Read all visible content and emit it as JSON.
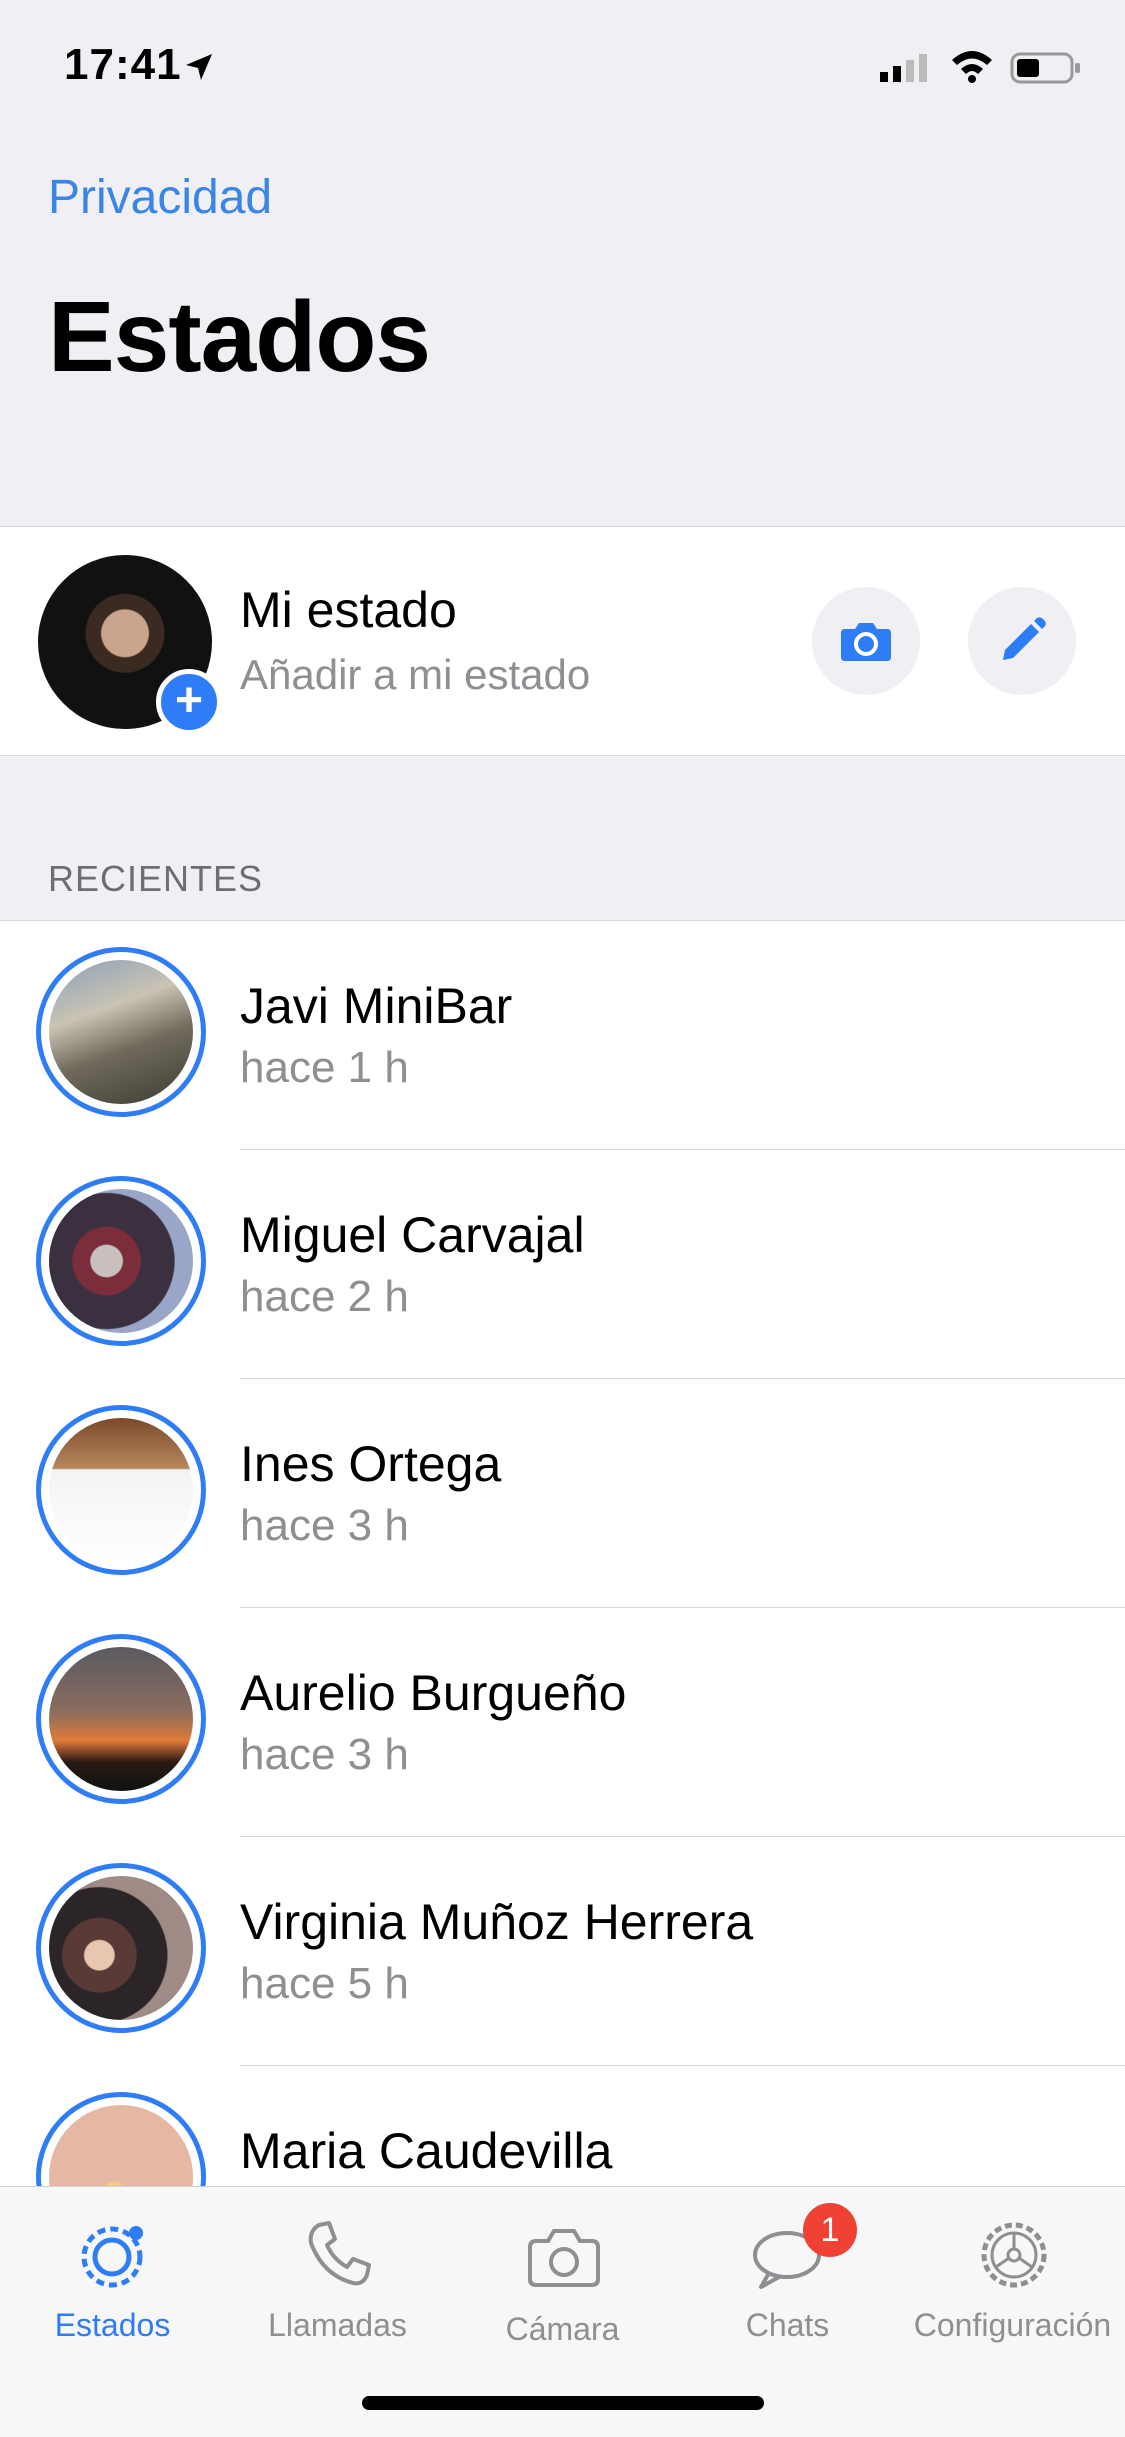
{
  "status_bar": {
    "time": "17:41"
  },
  "header": {
    "privacy_link": "Privacidad",
    "title": "Estados"
  },
  "my_status": {
    "name": "Mi estado",
    "subtitle": "Añadir a mi estado"
  },
  "section": {
    "recent_label": "RECIENTES"
  },
  "contacts": [
    {
      "name": "Javi MiniBar",
      "time": "hace 1 h"
    },
    {
      "name": "Miguel Carvajal",
      "time": "hace 2 h"
    },
    {
      "name": "Ines Ortega",
      "time": "hace 3 h"
    },
    {
      "name": "Aurelio Burgueño",
      "time": "hace 3 h"
    },
    {
      "name": "Virginia Muñoz Herrera",
      "time": "hace 5 h"
    },
    {
      "name": "Maria Caudevilla",
      "time": ""
    }
  ],
  "tabs": [
    {
      "label": "Estados",
      "active": true
    },
    {
      "label": "Llamadas"
    },
    {
      "label": "Cámara"
    },
    {
      "label": "Chats",
      "badge": "1"
    },
    {
      "label": "Configuración"
    }
  ],
  "colors": {
    "accent": "#2e7cf6",
    "link": "#3a85e6",
    "badge": "#f04135"
  }
}
